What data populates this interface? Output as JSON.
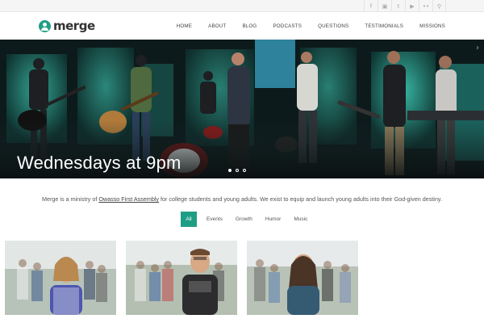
{
  "social": {
    "icons": [
      "facebook-icon",
      "instagram-icon",
      "twitter-icon",
      "youtube-icon",
      "flickr-icon",
      "search-icon"
    ]
  },
  "header": {
    "logo_text": "merge",
    "nav": [
      "HOME",
      "ABOUT",
      "BLOG",
      "PODCASTS",
      "QUESTIONS",
      "TESTIMONIALS",
      "MISSIONS"
    ]
  },
  "hero": {
    "caption": "Wednesdays at 9pm",
    "slides_total": 3,
    "active_slide": 1
  },
  "intro": {
    "before": "Merge is a ministry of ",
    "link": "Owasso First Assembly",
    "after": " for college students and young adults. We exist to equip and launch young adults into their God-given destiny."
  },
  "filters": [
    "All",
    "Events",
    "Growth",
    "Humor",
    "Music"
  ],
  "colors": {
    "accent": "#1f9e86",
    "hero_glow": "#35c4b0"
  }
}
